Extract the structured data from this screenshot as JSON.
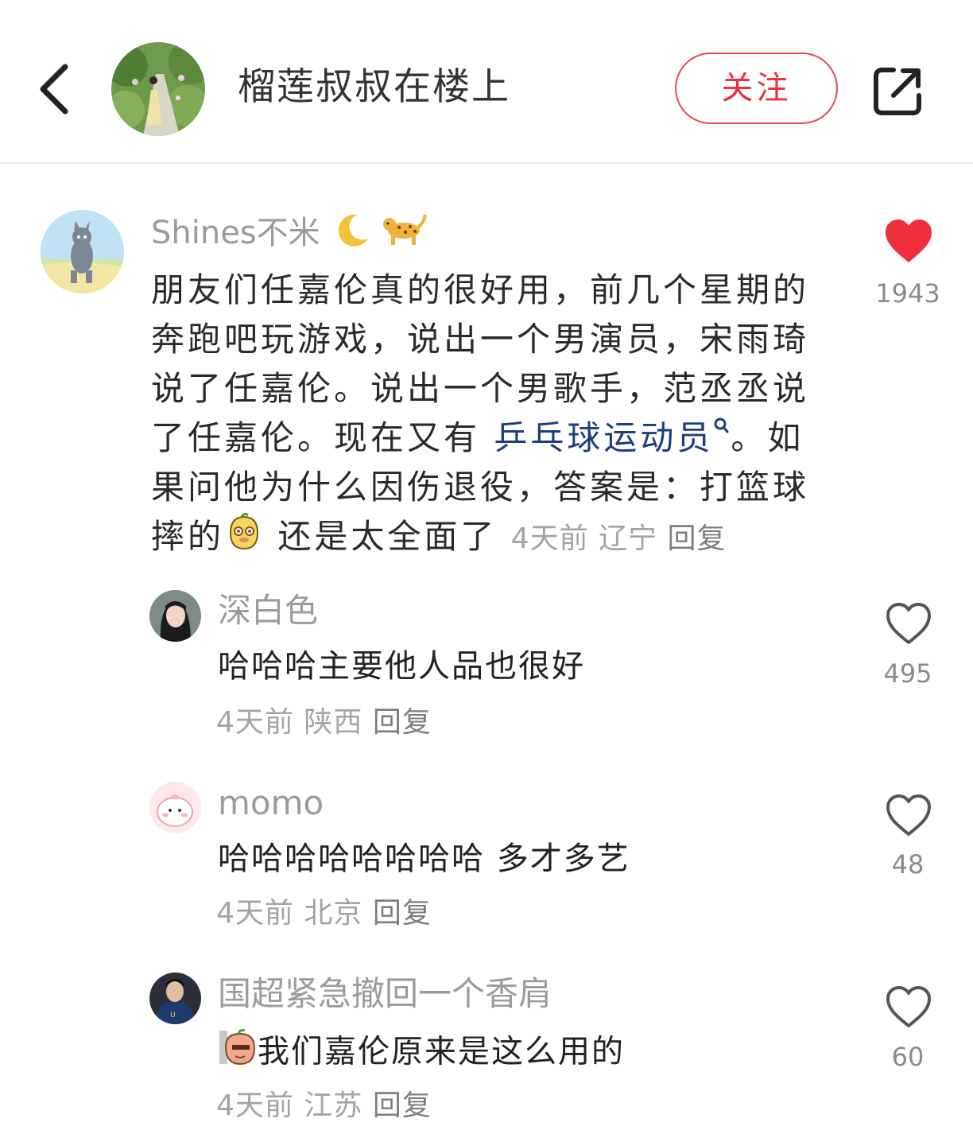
{
  "header": {
    "title": "榴莲叔叔在楼上",
    "follow_label": "关注"
  },
  "comment": {
    "username": "Shines不米",
    "text_lines": [
      "朋友们任嘉伦真的很好用，前几个星期的",
      "奔跑吧玩游戏，说出一个男演员，宋雨琦",
      "说了任嘉伦。说出一个男歌手，范丞丞说",
      "了任嘉伦。现在又有 ",
      "果问他为什么因伤退役，答案是：打篮球",
      "摔的"
    ],
    "keyword": "乒乓球运动员",
    "after_keyword": "。如",
    "after_emoji": " 还是太全面了 ",
    "time": "4天前",
    "location": "辽宁",
    "reply_label": "回复",
    "likes": "1943",
    "liked": true
  },
  "replies": [
    {
      "username": "深白色",
      "text": "哈哈哈主要他人品也很好",
      "time": "4天前",
      "location": "陕西",
      "reply_label": "回复",
      "likes": "495"
    },
    {
      "username": "momo",
      "text": "哈哈哈哈哈哈哈哈 多才多艺",
      "time": "4天前",
      "location": "北京",
      "reply_label": "回复",
      "likes": "48"
    },
    {
      "username": "国超紧急撤回一个香肩",
      "text": "我们嘉伦原来是这么用的",
      "time": "4天前",
      "location": "江苏",
      "reply_label": "回复",
      "likes": "60"
    }
  ],
  "colors": {
    "accent": "#e8303f",
    "liked_heart": "#ef2f3c",
    "keyword": "#1d3e7a"
  }
}
